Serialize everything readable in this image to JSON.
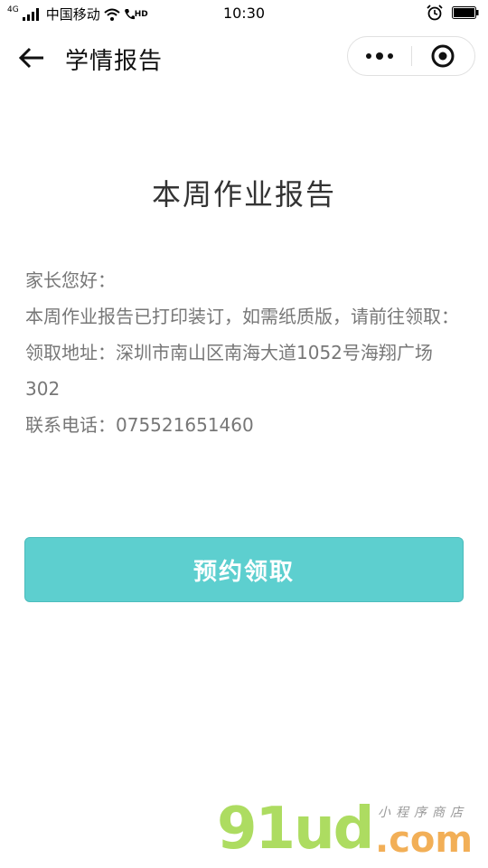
{
  "status_bar": {
    "network": "4G",
    "carrier": "中国移动",
    "hd": "HD",
    "time": "10:30"
  },
  "nav": {
    "title": "学情报告"
  },
  "report": {
    "title": "本周作业报告",
    "greeting": "家长您好：",
    "notice": "本周作业报告已打印装订，如需纸质版，请前往领取：",
    "address_label": "领取地址：",
    "address": "深圳市南山区南海大道1052号海翔广场302",
    "phone_label": "联系电话：",
    "phone": "075521651460"
  },
  "button": {
    "label": "预约领取"
  },
  "watermark": {
    "main": "91ud",
    "com": ".com",
    "sub": "小程序商店"
  }
}
